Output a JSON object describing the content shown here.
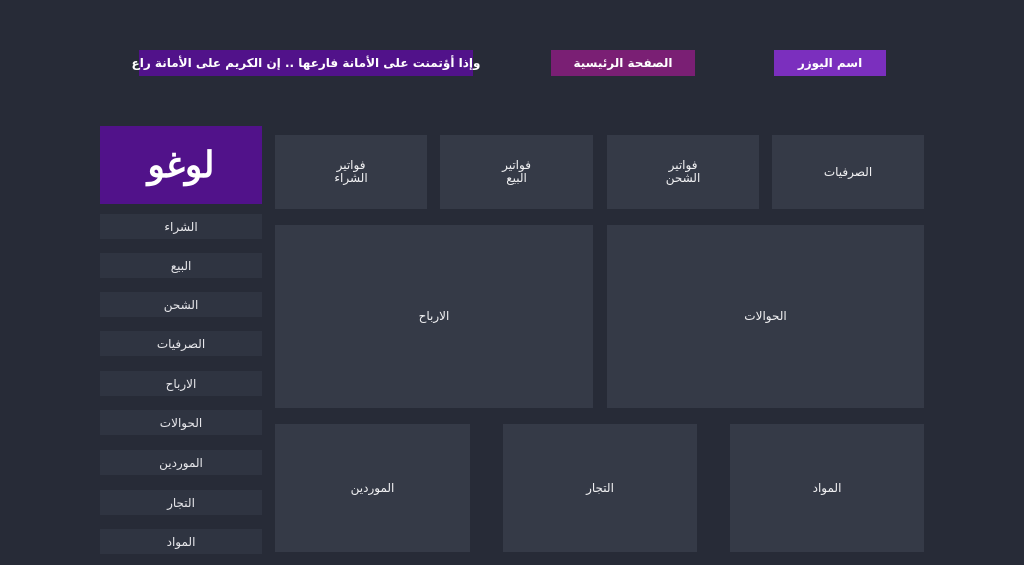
{
  "header": {
    "user_label": "اسم اليوزر",
    "home_label": "الصفحة الرئيسية",
    "quote": "وإذا أؤتمنت على الأمانة فارعها .. إن الكريم على الأمانة راع"
  },
  "logo": "لوغو",
  "sidebar": {
    "items": [
      {
        "label": "الشراء"
      },
      {
        "label": "البيع"
      },
      {
        "label": "الشحن"
      },
      {
        "label": "الصرفيات"
      },
      {
        "label": "الارباح"
      },
      {
        "label": "الحوالات"
      },
      {
        "label": "الموردين"
      },
      {
        "label": "التجار"
      },
      {
        "label": "المواد"
      }
    ]
  },
  "cards": {
    "row1": [
      {
        "label": "الصرفيات"
      },
      {
        "label": "فواتير\nالشحن"
      },
      {
        "label": "فواتير\nالبيع"
      },
      {
        "label": "فواتير\nالشراء"
      }
    ],
    "row2": [
      {
        "label": "الحوالات"
      },
      {
        "label": "الارباح"
      }
    ],
    "row3": [
      {
        "label": "المواد"
      },
      {
        "label": "التجار"
      },
      {
        "label": "الموردين"
      }
    ]
  },
  "colors": {
    "background": "#272b37",
    "card": "#353a47",
    "sidebar_item": "#2f3441",
    "purple_dark": "#51128a",
    "purple_light": "#7b2fbe",
    "magenta": "#7a1f74"
  }
}
